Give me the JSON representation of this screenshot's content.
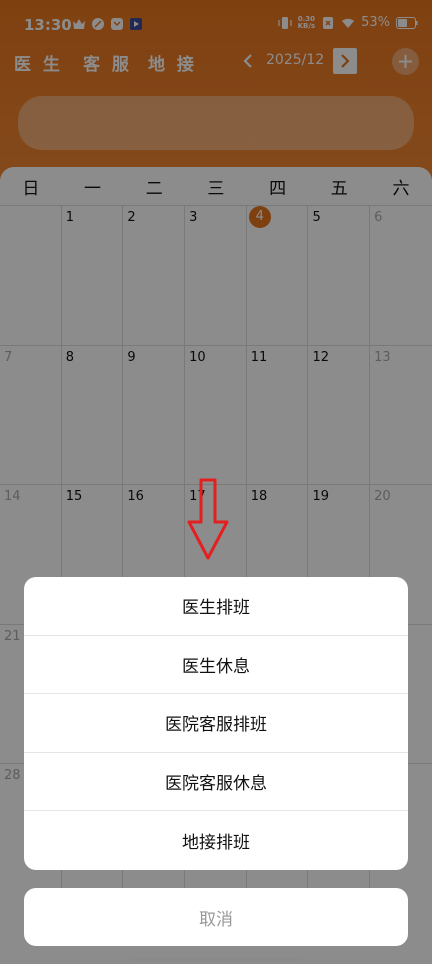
{
  "status_bar": {
    "time": "13:30",
    "net_speed_value": "0.30",
    "net_speed_unit": "KB/s",
    "battery": "53%"
  },
  "header": {
    "tabs": [
      "医 生",
      "客 服",
      "地 接"
    ],
    "month": "2025/12"
  },
  "calendar": {
    "weekdays": [
      "日",
      "一",
      "二",
      "三",
      "四",
      "五",
      "六"
    ],
    "rows": [
      [
        "",
        "1",
        "2",
        "3",
        "4",
        "5",
        "6"
      ],
      [
        "7",
        "8",
        "9",
        "10",
        "11",
        "12",
        "13"
      ],
      [
        "14",
        "15",
        "16",
        "17",
        "18",
        "19",
        "20"
      ],
      [
        "21",
        "",
        "",
        "",
        "",
        "",
        ""
      ],
      [
        "28",
        "",
        "",
        "",
        "",
        "",
        ""
      ]
    ],
    "today": "4"
  },
  "action_sheet": {
    "items": [
      "医生排班",
      "医生休息",
      "医院客服排班",
      "医院客服休息",
      "地接排班"
    ],
    "cancel": "取消"
  },
  "colors": {
    "accent": "#e8761e"
  }
}
